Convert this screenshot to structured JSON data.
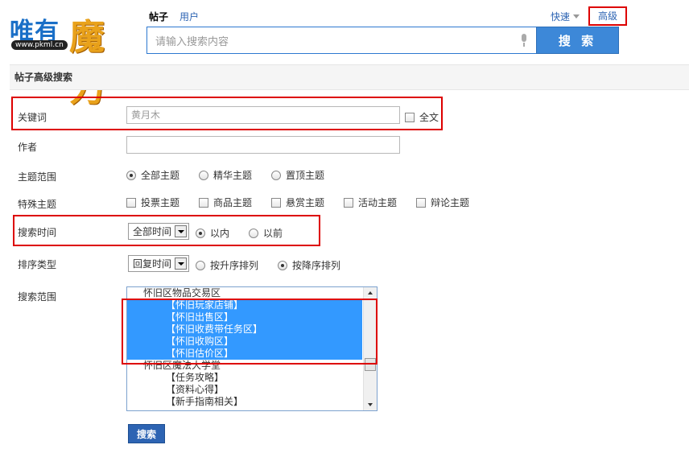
{
  "logo": {
    "text_left": "唯有",
    "text_right": "魔力",
    "url": "www.pkml.cn"
  },
  "top_tabs": [
    {
      "label": "帖子",
      "active": true
    },
    {
      "label": "用户",
      "active": false
    }
  ],
  "quick_label": "快速",
  "advanced_label": "高级",
  "search": {
    "placeholder": "请输入搜索内容",
    "button_label": "搜 索"
  },
  "panel_title": "帖子高级搜索",
  "form": {
    "keyword": {
      "label": "关键词",
      "value": "黄月木",
      "fulltext_label": "全文"
    },
    "author": {
      "label": "作者",
      "value": ""
    },
    "topic_scope": {
      "label": "主题范围",
      "options": [
        {
          "label": "全部主题",
          "checked": true
        },
        {
          "label": "精华主题",
          "checked": false
        },
        {
          "label": "置顶主题",
          "checked": false
        }
      ]
    },
    "special_topics": {
      "label": "特殊主题",
      "options": [
        "投票主题",
        "商品主题",
        "悬赏主题",
        "活动主题",
        "辩论主题"
      ]
    },
    "search_time": {
      "label": "搜索时间",
      "select_value": "全部时间",
      "options": [
        {
          "label": "以内",
          "checked": true
        },
        {
          "label": "以前",
          "checked": false
        }
      ]
    },
    "sort_type": {
      "label": "排序类型",
      "select_value": "回复时间",
      "options": [
        {
          "label": "按升序排列",
          "checked": false
        },
        {
          "label": "按降序排列",
          "checked": true
        }
      ]
    },
    "search_range": {
      "label": "搜索范围",
      "items": [
        {
          "label": "怀旧区物品交易区",
          "indent": 1,
          "selected": false
        },
        {
          "label": "【怀旧玩家店铺】",
          "indent": 2,
          "selected": true
        },
        {
          "label": "【怀旧出售区】",
          "indent": 2,
          "selected": true
        },
        {
          "label": "【怀旧收费带任务区】",
          "indent": 2,
          "selected": true
        },
        {
          "label": "【怀旧收购区】",
          "indent": 2,
          "selected": true
        },
        {
          "label": "【怀旧估价区】",
          "indent": 2,
          "selected": true
        },
        {
          "label": "怀旧区魔法大学堂",
          "indent": 1,
          "selected": false
        },
        {
          "label": "【任务攻略】",
          "indent": 2,
          "selected": false
        },
        {
          "label": "【资料心得】",
          "indent": 2,
          "selected": false
        },
        {
          "label": "【新手指南相关】",
          "indent": 2,
          "selected": false
        }
      ]
    },
    "submit_label": "搜索"
  }
}
